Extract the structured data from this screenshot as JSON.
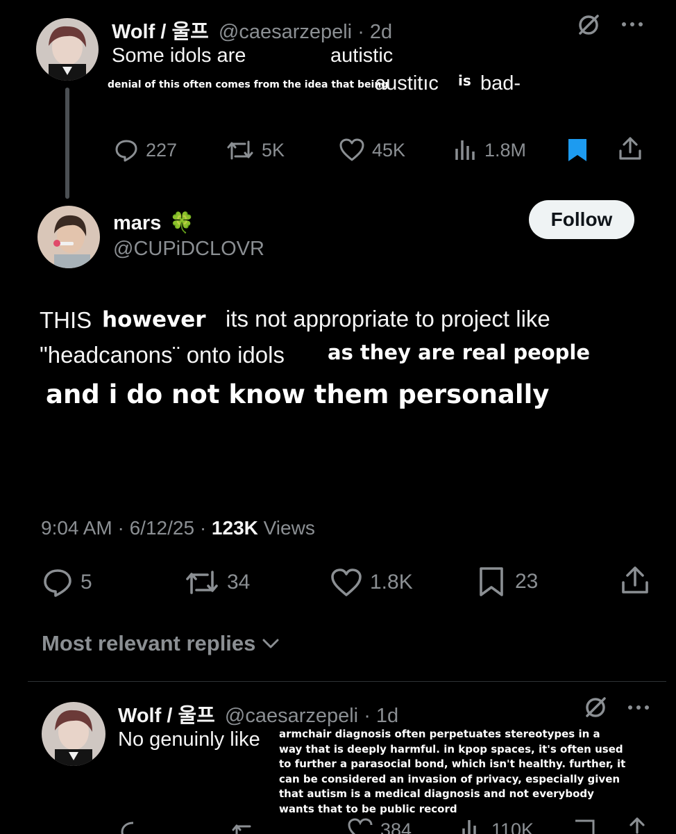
{
  "original_tweet": {
    "name": "Wolf / 울프",
    "handle": "@caesarzepeli",
    "time": "· 2d",
    "text_line1": "Some idols are",
    "text_word": "autistic",
    "overlay_small": "denial of this often comes from the idea that being",
    "text_austitic": "austitıc",
    "overlay_is": "is",
    "text_bad": "bad-",
    "stats": {
      "replies": "227",
      "reposts": "5K",
      "likes": "45K",
      "views": "1.8M"
    },
    "bookmark_color": "#1d9bf0"
  },
  "main_tweet": {
    "name": "mars",
    "name_emoji": "🍀",
    "handle": "@CUPiDCLOVR",
    "follow_label": "Follow",
    "text_this": "THIS",
    "overlay_however": "however",
    "text_rest1": "its not appropriate to project like",
    "text_line2": "\"headcanons¨ onto idols",
    "overlay_real": "as they are real people",
    "overlay_personally": "and i do not know them personally",
    "timestamp": "9:04 AM · 6/12/25 ·",
    "views_count": "123K",
    "views_label": "Views",
    "stats": {
      "replies": "5",
      "reposts": "34",
      "likes": "1.8K",
      "bookmarks": "23"
    }
  },
  "replies_section": {
    "label": "Most relevant replies"
  },
  "reply_tweet": {
    "name": "Wolf / 울프",
    "handle": "@caesarzepeli",
    "time": "· 1d",
    "text": "No genuinly like",
    "overlay_lines": [
      "armchair diagnosis often perpetuates stereotypes in a",
      "way that is deeply harmful. in kpop spaces, it's often used",
      "to further a parasocial bond, which isn't healthy. further, it",
      "can be considered an invasion of privacy, especially given",
      "that autism is a medical diagnosis and not everybody",
      "wants that to be public record"
    ],
    "stats": {
      "likes": "384",
      "views": "110K"
    }
  },
  "colors": {
    "background": "#000000",
    "text": "#e7e9ea",
    "muted": "#8b8f93",
    "accent": "#1d9bf0"
  }
}
